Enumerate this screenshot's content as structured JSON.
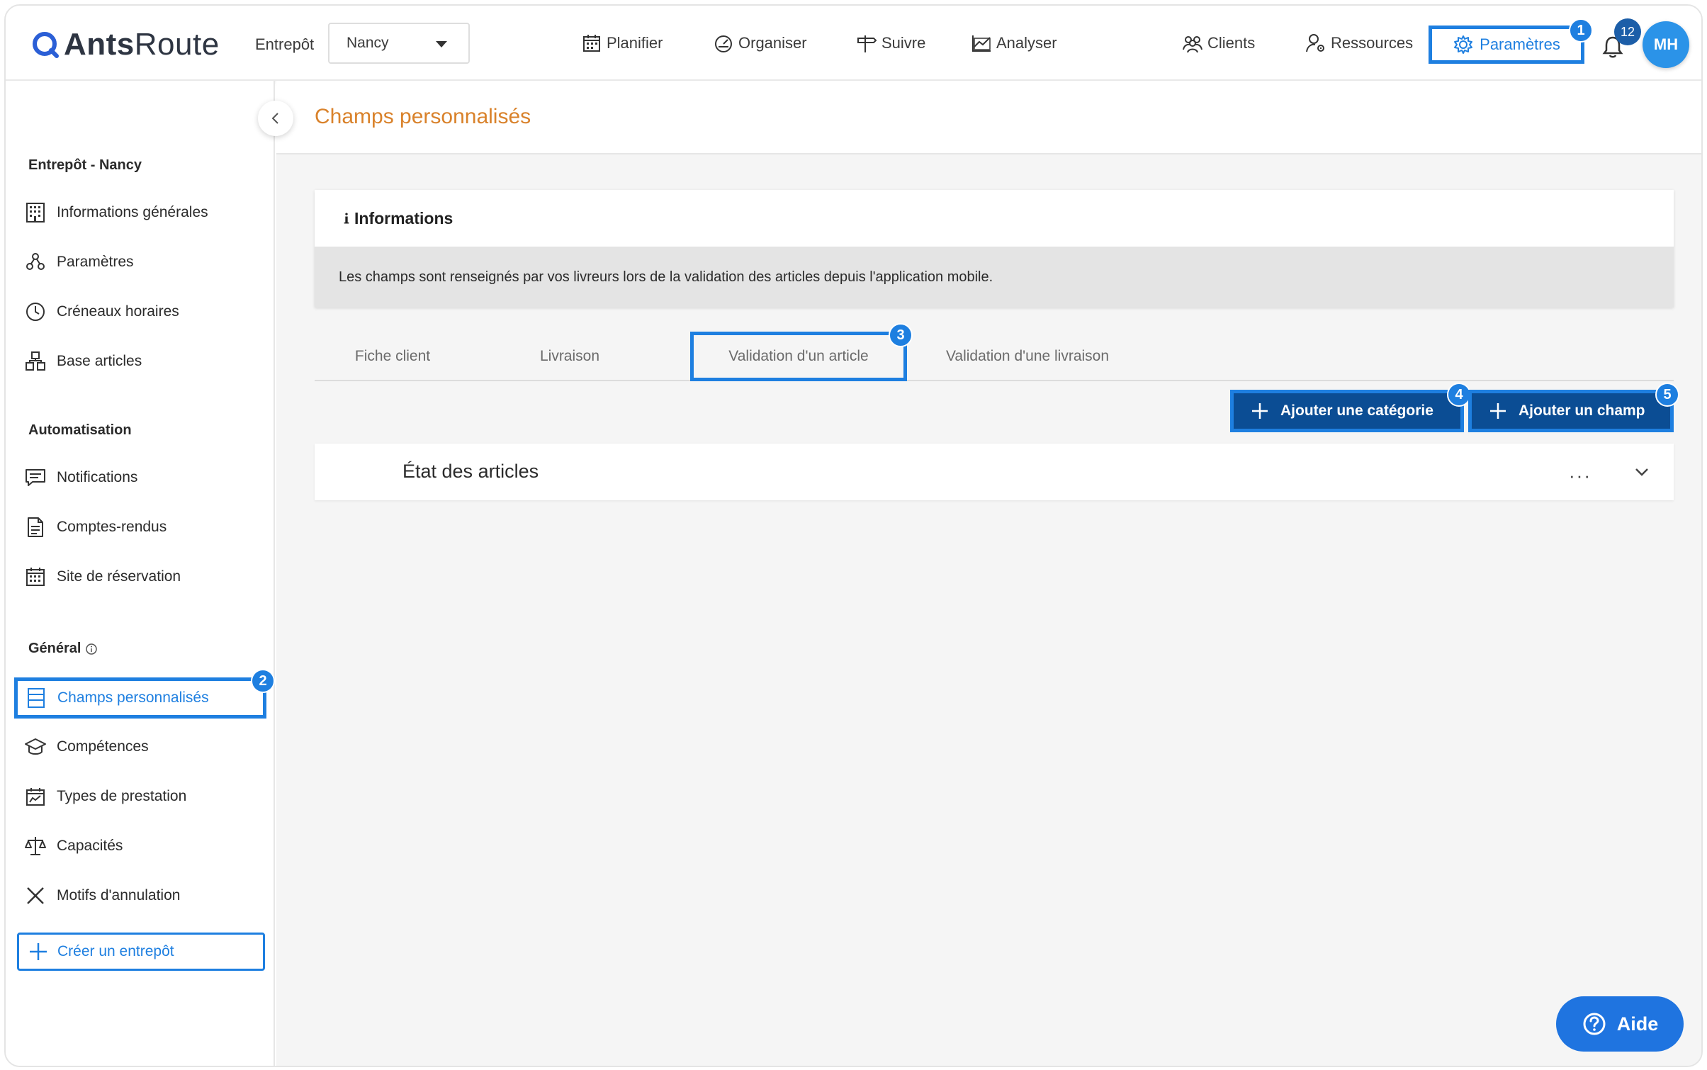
{
  "header": {
    "logo_text_bold": "Ants",
    "logo_text_light": "Route",
    "warehouse_label": "Entrepôt",
    "warehouse_selected": "Nancy",
    "nav": [
      {
        "label": "Planifier",
        "icon": "calendar-icon"
      },
      {
        "label": "Organiser",
        "icon": "gauge-icon"
      },
      {
        "label": "Suivre",
        "icon": "signpost-icon"
      },
      {
        "label": "Analyser",
        "icon": "chart-icon"
      },
      {
        "label": "Clients",
        "icon": "users-icon"
      },
      {
        "label": "Ressources",
        "icon": "user-gear-icon"
      }
    ],
    "params_label": "Paramètres",
    "notifications_count": "12",
    "avatar_initials": "MH"
  },
  "step_badges": [
    "1",
    "2",
    "3",
    "4",
    "5"
  ],
  "sidebar": {
    "section_warehouse": "Entrepôt - Nancy",
    "warehouse_items": [
      {
        "label": "Informations générales",
        "icon": "building-icon"
      },
      {
        "label": "Paramètres",
        "icon": "nodes-icon"
      },
      {
        "label": "Créneaux horaires",
        "icon": "clock-icon"
      },
      {
        "label": "Base articles",
        "icon": "boxes-icon"
      }
    ],
    "section_automation": "Automatisation",
    "automation_items": [
      {
        "label": "Notifications",
        "icon": "message-icon"
      },
      {
        "label": "Comptes-rendus",
        "icon": "document-icon"
      },
      {
        "label": "Site de réservation",
        "icon": "calendar-grid-icon"
      }
    ],
    "section_general": "Général",
    "general_items": [
      {
        "label": "Champs personnalisés",
        "icon": "fields-icon",
        "active": true
      },
      {
        "label": "Compétences",
        "icon": "graduation-icon"
      },
      {
        "label": "Types de prestation",
        "icon": "service-icon"
      },
      {
        "label": "Capacités",
        "icon": "scale-icon"
      },
      {
        "label": "Motifs d'annulation",
        "icon": "x-icon"
      }
    ],
    "create_label": "Créer un entrepôt"
  },
  "main": {
    "page_title": "Champs personnalisés",
    "info_title": "Informations",
    "info_text": "Les champs sont renseignés par vos livreurs lors de la validation des articles depuis l'application mobile.",
    "tabs": [
      "Fiche client",
      "Livraison",
      "Validation d'un article",
      "Validation d'une livraison"
    ],
    "active_tab": "Validation d'un article",
    "add_category_label": "Ajouter une catégorie",
    "add_field_label": "Ajouter un champ",
    "category_name": "État des articles",
    "more_label": "···"
  },
  "help_label": "Aide",
  "colors": {
    "accent": "#1e7fe0",
    "primary_dark": "#0b4d94",
    "title_orange": "#d9822b",
    "avatar": "#2b93e8"
  }
}
